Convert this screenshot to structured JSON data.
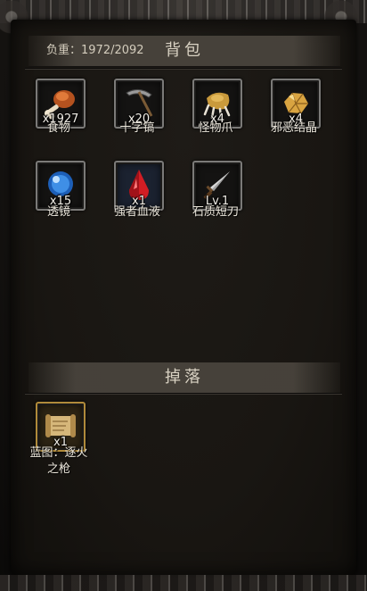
{
  "backpack": {
    "weight_label": "负重：1972/2092",
    "title": "背包",
    "items": [
      {
        "icon": "meat-icon",
        "qty": "x1927",
        "name": "食物"
      },
      {
        "icon": "pickaxe-icon",
        "qty": "x20",
        "name": "十字镐"
      },
      {
        "icon": "claw-icon",
        "qty": "x4",
        "name": "怪物爪"
      },
      {
        "icon": "crystal-icon",
        "qty": "x4",
        "name": "邪恶结晶"
      },
      {
        "icon": "lens-icon",
        "qty": "x15",
        "name": "透镜"
      },
      {
        "icon": "blood-drop-icon",
        "qty": "x1",
        "name": "强者血液"
      },
      {
        "icon": "blade-icon",
        "qty": "Lv.1",
        "name": "石质短刀"
      }
    ]
  },
  "drops": {
    "title": "掉落",
    "items": [
      {
        "icon": "scroll-icon",
        "qty": "x1",
        "name_line1": "蓝图：逐火",
        "name_line2": "之枪"
      }
    ]
  }
}
